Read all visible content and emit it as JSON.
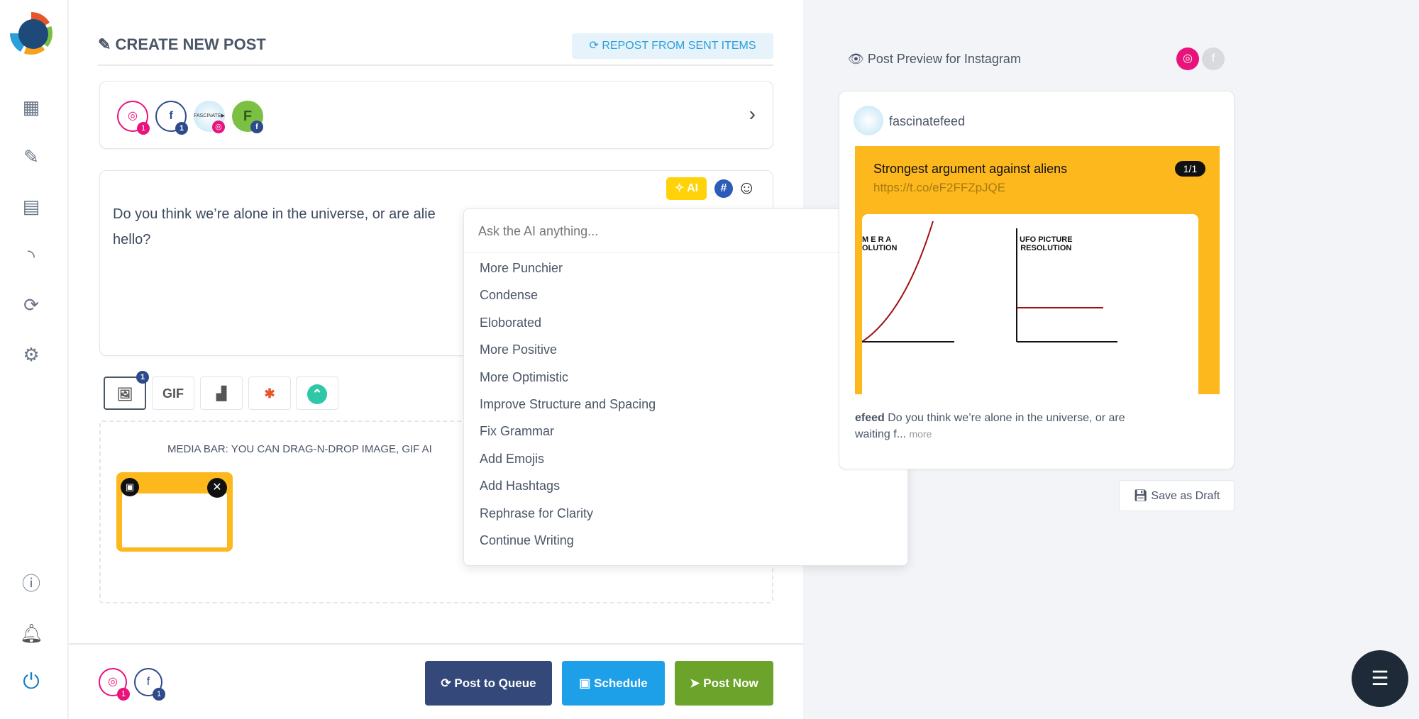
{
  "sidebar": {
    "items": [
      "logo",
      "dashboard-icon",
      "compose-icon",
      "posts-icon",
      "rss-icon",
      "recycle-icon",
      "settings-icon",
      "info-icon",
      "bell-icon",
      "power-icon"
    ]
  },
  "header": {
    "title": "CREATE NEW POST",
    "repost": "REPOST FROM SENT ITEMS"
  },
  "accounts": [
    {
      "type": "instagram",
      "count": "1"
    },
    {
      "type": "facebook",
      "count": "1"
    },
    {
      "type": "fascinatefeed-instagram"
    },
    {
      "type": "F-facebook",
      "letter": "F"
    }
  ],
  "editor": {
    "text_line1": "Do you think we’re alone in the universe, or are alie",
    "text_line2": "hello?",
    "ai_label": "AI",
    "hashtag": "#",
    "emoji": "☺"
  },
  "ai_menu": {
    "placeholder": "Ask the AI anything...",
    "items": [
      "More Punchier",
      "Condense",
      "Eloborated",
      "More Positive",
      "More Optimistic",
      "Improve Structure and Spacing",
      "Fix Grammar",
      "Add Emojis",
      "Add Hashtags",
      "Rephrase for Clarity",
      "Continue Writing"
    ]
  },
  "media": {
    "tools": [
      "image",
      "GIF",
      "unsplash",
      "google-photos",
      "canva"
    ],
    "image_count": "1",
    "bar_text": "MEDIA BAR: YOU CAN DRAG-N-DROP IMAGE, GIF AI"
  },
  "footer": {
    "ig_count": "1",
    "fb_count": "1",
    "queue": "Post to Queue",
    "schedule": "Schedule",
    "post_now": "Post Now"
  },
  "preview": {
    "title": "Post Preview for Instagram",
    "username": "fascinatefeed",
    "image_title": "Strongest argument against aliens",
    "image_link": "https://t.co/eF2FFZpJQE",
    "counter": "1/1",
    "chart1_label": "M E R A\nOLUTION",
    "chart2_label": "UFO PICTURE\nRESOLUTION",
    "caption_user": "efeed",
    "caption_text": "Do you think we’re alone in the universe, or are",
    "caption_line2": "waiting f...",
    "more": "more",
    "save_draft": "Save as Draft"
  },
  "colors": {
    "instagram": "#e8137b",
    "facebook": "#2d4a8a",
    "queue": "#34497a",
    "schedule": "#1ea0e8",
    "post_now": "#6ba32b",
    "ai": "#ffd20a"
  }
}
